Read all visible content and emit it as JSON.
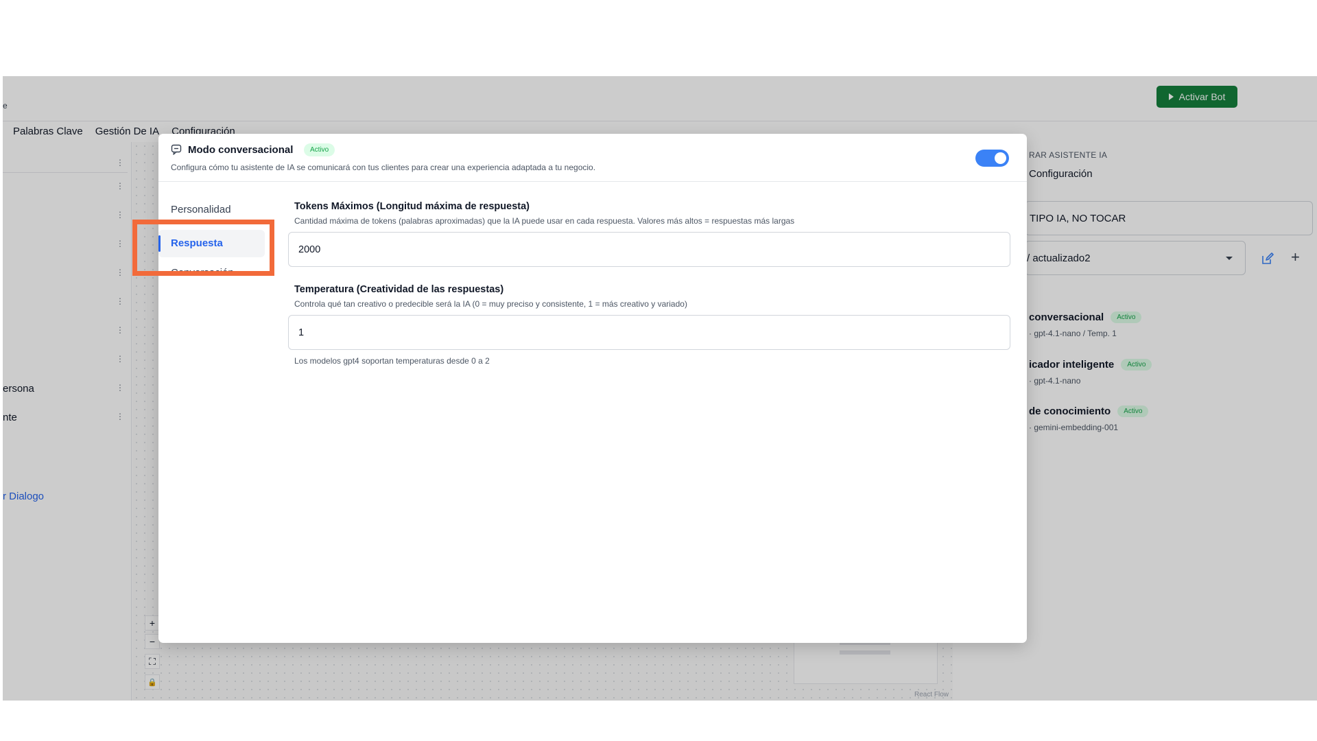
{
  "topbar": {
    "cut_letter": "e",
    "activate_label": "Activar Bot"
  },
  "menu": {
    "items": [
      "Palabras Clave",
      "Gestión De IA",
      "Configuración"
    ]
  },
  "left_panel": {
    "rows": [
      "ersona",
      "nte"
    ],
    "link": "r Dialogo"
  },
  "canvas": {
    "zoom_in": "+",
    "zoom_out": "−",
    "fit": "⛶",
    "lock": "🔒",
    "attribution": "React Flow"
  },
  "right_panel": {
    "heading": "RAR ASISTENTE IA",
    "tab": "Configuración",
    "name_value": "TIPO IA, NO TOCAR",
    "select_value": "/ actualizado2",
    "plus": "+",
    "agents": [
      {
        "name": "conversacional",
        "badge": "Activo",
        "sub": "· gpt-4.1-nano / Temp. 1"
      },
      {
        "name": "icador inteligente",
        "badge": "Activo",
        "sub": "· gpt-4.1-nano"
      },
      {
        "name": "de conocimiento",
        "badge": "Activo",
        "sub": "· gemini-embedding-001"
      }
    ]
  },
  "modal": {
    "title": "Modo conversacional",
    "badge": "Activo",
    "description": "Configura cómo tu asistente de IA se comunicará con tus clientes para crear una experiencia adaptada a tu negocio.",
    "toggle_on": true,
    "nav": {
      "items": [
        "Personalidad",
        "Respuesta",
        "Conversación"
      ],
      "active": "Respuesta"
    },
    "fields": {
      "max_tokens": {
        "label": "Tokens Máximos (Longitud máxima de respuesta)",
        "help": "Cantidad máxima de tokens (palabras aproximadas) que la IA puede usar en cada respuesta. Valores más altos = respuestas más largas",
        "value": "2000"
      },
      "temperature": {
        "label": "Temperatura (Creatividad de las respuestas)",
        "help": "Controla qué tan creativo o predecible será la IA (0 = muy preciso y consistente, 1 = más creativo y variado)",
        "value": "1",
        "note": "Los modelos gpt4 soportan temperaturas desde 0 a 2"
      }
    }
  },
  "colors": {
    "accent": "#2563eb",
    "toggle": "#3b82f6",
    "activate": "#15803d",
    "highlight": "#f26a3a",
    "badge_text": "#16a34a",
    "badge_bg": "#dcfce7"
  }
}
